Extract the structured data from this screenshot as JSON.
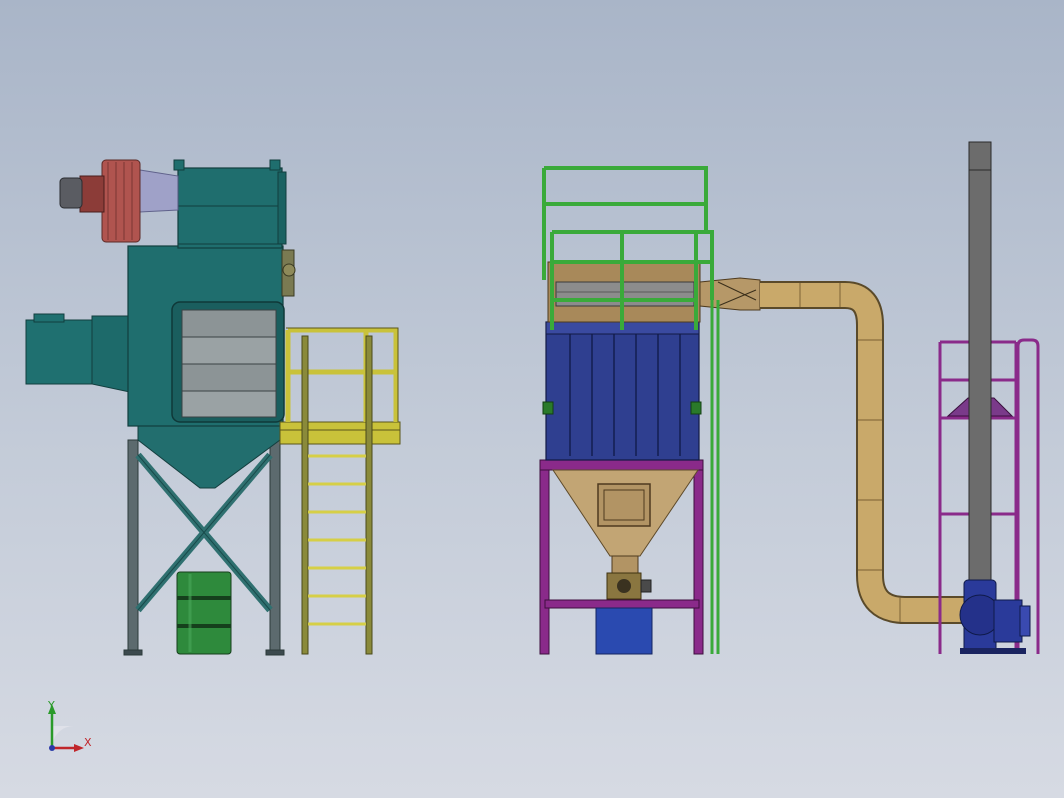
{
  "viewport": {
    "background_top": "#a9b5c8",
    "background_bottom": "#d6dae3"
  },
  "triad": {
    "x_label": "X",
    "y_label": "Y",
    "x_color": "#c0262b",
    "y_color": "#2a9a2a",
    "z_color": "#2a3aa8"
  },
  "colors": {
    "collector_teal": "#1f6e6e",
    "fan_red": "#b0544f",
    "platform_yellow": "#c9c23a",
    "baghouse_blue": "#2f3f90",
    "hopper_tan": "#c2a574",
    "frame_magenta": "#8a2a8a",
    "railing_green": "#3aaa3a",
    "duct_tan": "#c9a96a",
    "stack_gray": "#6c6c6c",
    "blower_blue": "#2a3a9a",
    "drum_green": "#2e8a3c"
  }
}
